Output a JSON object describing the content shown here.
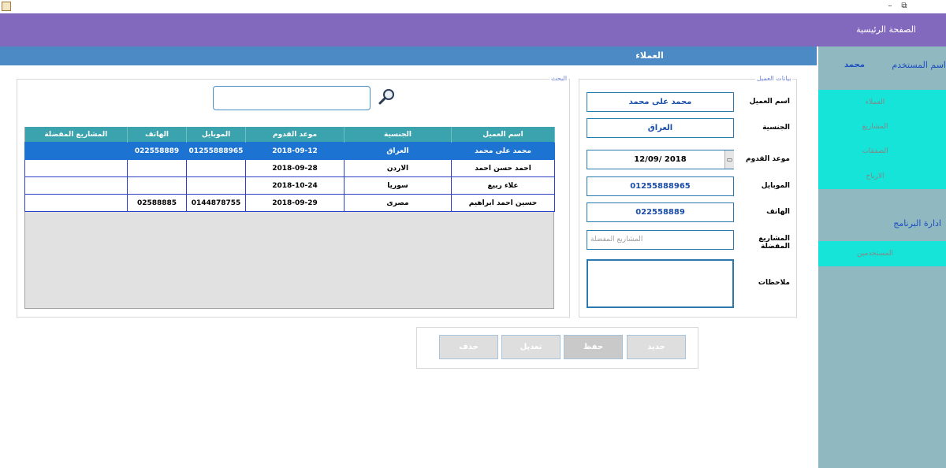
{
  "window": {
    "minimize": "–",
    "restore": "⧉"
  },
  "header": {
    "home_link": "الصفحة الرئيسية"
  },
  "section": {
    "title": "العملاء"
  },
  "sidebar": {
    "user_label": "اسم المستخدم",
    "user_name": "محمد",
    "menu": [
      "العملاء",
      "المشاريع",
      "الصفقات",
      "الارباح"
    ],
    "admin_label": "ادارة البرنامج",
    "users_label": "المستخدمين"
  },
  "search": {
    "legend": "البحث",
    "value": ""
  },
  "table": {
    "columns": [
      "المشاريع المفضلة",
      "الهاتف",
      "الموبايل",
      "موعد القدوم",
      "الجنسية",
      "اسم العميل"
    ],
    "rows": [
      {
        "fav": "",
        "phone": "022558889",
        "mobile": "01255888965",
        "date": "2018-09-12",
        "nationality": "العراق",
        "name": "محمد على محمد"
      },
      {
        "fav": "",
        "phone": "",
        "mobile": "",
        "date": "2018-09-28",
        "nationality": "الاردن",
        "name": "احمد حسن احمد"
      },
      {
        "fav": "",
        "phone": "",
        "mobile": "",
        "date": "2018-10-24",
        "nationality": "سوريا",
        "name": "علاء ربيع"
      },
      {
        "fav": "",
        "phone": "02588885",
        "mobile": "0144878755",
        "date": "2018-09-29",
        "nationality": "مصرى",
        "name": "حسين احمد ابراهيم"
      }
    ],
    "selected_row": 0
  },
  "customer": {
    "legend": "بيانات العميل",
    "labels": {
      "name": "اسم العميل",
      "nationality": "الجنسية",
      "date": "موعد القدوم",
      "mobile": "الموبايل",
      "phone": "الهاتف",
      "fav": "المشاريع المفضلة",
      "notes": "ملاحظات"
    },
    "values": {
      "name": "محمد على محمد",
      "nationality": "العراق",
      "date": "12/09/ 2018",
      "mobile": "01255888965",
      "phone": "022558889",
      "fav_placeholder": "المشاريع المفضلة"
    }
  },
  "buttons": {
    "new": "جديد",
    "save": "حفظ",
    "edit": "تعديل",
    "delete": "حذف"
  }
}
